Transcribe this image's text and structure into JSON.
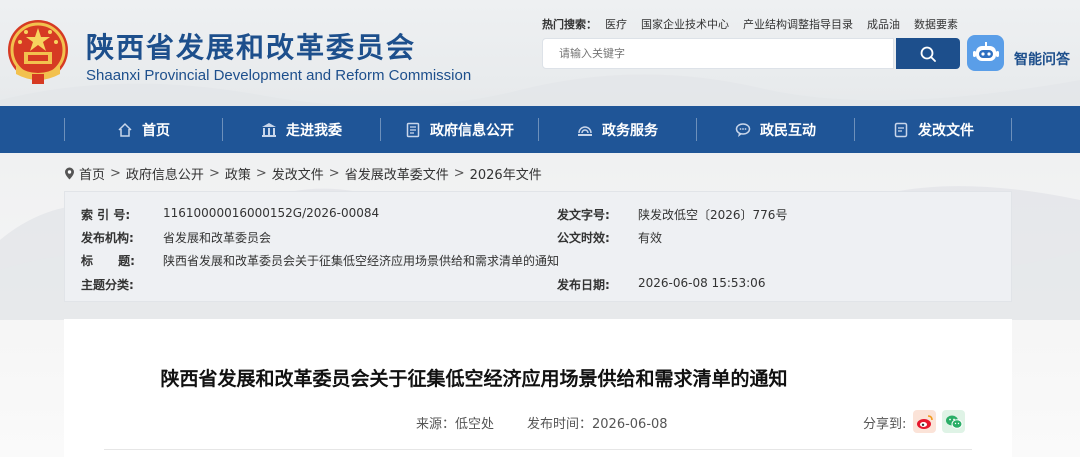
{
  "header": {
    "title": "陕西省发展和改革委员会",
    "subtitle": "Shaanxi Provincial Development and Reform Commission",
    "hot_label": "热门搜索：",
    "hot_links": [
      "医疗",
      "国家企业技术中心",
      "产业结构调整指导目录",
      "成品油",
      "数据要素"
    ],
    "search_placeholder": "请输入关键字",
    "ai_label": "智能问答"
  },
  "nav": {
    "items": [
      {
        "label": "首页",
        "icon": "home-icon"
      },
      {
        "label": "走进我委",
        "icon": "building-icon"
      },
      {
        "label": "政府信息公开",
        "icon": "document-icon"
      },
      {
        "label": "政务服务",
        "icon": "service-icon"
      },
      {
        "label": "政民互动",
        "icon": "chat-icon"
      },
      {
        "label": "发改文件",
        "icon": "file-icon"
      }
    ]
  },
  "breadcrumb": {
    "items": [
      "首页",
      "政府信息公开",
      "政策",
      "发改文件",
      "省发展改革委文件",
      "2026年文件"
    ],
    "separator": ">"
  },
  "info": {
    "index_label": "索 引 号:",
    "index_value": "11610000016000152G/2026-00084",
    "docno_label": "发文字号:",
    "docno_value": "陕发改低空〔2026〕776号",
    "org_label": "发布机构:",
    "org_value": "省发展和改革委员会",
    "validity_label": "公文时效:",
    "validity_value": "有效",
    "title_label": "标      题:",
    "title_value": "陕西省发展和改革委员会关于征集低空经济应用场景供给和需求清单的通知",
    "topic_label": "主题分类:",
    "topic_value": "",
    "date_label": "发布日期:",
    "date_value": "2026-06-08 15:53:06"
  },
  "article": {
    "title": "陕西省发展和改革委员会关于征集低空经济应用场景供给和需求清单的通知",
    "source": "来源：低空处",
    "publish_time": "发布时间：2026-06-08",
    "share_label": "分享到:",
    "share_targets": [
      "weibo-icon",
      "wechat-icon"
    ]
  },
  "colors": {
    "brand": "#1d4f8c",
    "nav_bg": "#1f5597",
    "weibo": "#e6162d",
    "wechat": "#2aae67"
  }
}
